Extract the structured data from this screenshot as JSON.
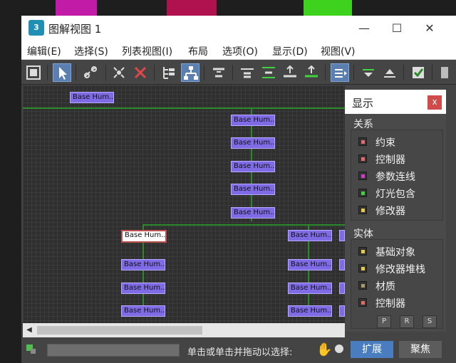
{
  "window": {
    "title": "图解视图 1",
    "app_icon": "3"
  },
  "controls": {
    "minimize": "—",
    "maximize": "☐",
    "close": "✕"
  },
  "menu": [
    "编辑(E)",
    "选择(S)",
    "列表视图(I)",
    "布局",
    "选项(O)",
    "显示(D)",
    "视图(V)"
  ],
  "canvas": {
    "node_label": "Base Hum...",
    "nodes": [
      "Base Hum...",
      "Base Hum...",
      "Base Hum...",
      "Base Hum...",
      "Base Hum...",
      "Base Hum...",
      "Base Hum...",
      "Base Hum...",
      "Base Hum...",
      "Base Hum...",
      "Base Hum...",
      "Base Hum...",
      "Base Hum...",
      "Base Hum...",
      "Base Hum...",
      "Base Hum..."
    ]
  },
  "panel": {
    "title": "显示",
    "close": "x",
    "relations_label": "关系",
    "relations": [
      {
        "label": "约束",
        "color": "#e36b6b"
      },
      {
        "label": "控制器",
        "color": "#e36b6b"
      },
      {
        "label": "参数连线",
        "color": "#d13ad1"
      },
      {
        "label": "灯光包含",
        "color": "#3fd43f"
      },
      {
        "label": "修改器",
        "color": "#e6c84a"
      }
    ],
    "entities_label": "实体",
    "entities": [
      {
        "label": "基础对象",
        "color": "#e6c84a"
      },
      {
        "label": "修改器堆栈",
        "color": "#e6c84a"
      },
      {
        "label": "材质",
        "color": "#a89a6a"
      },
      {
        "label": "控制器",
        "color": "#e36b6b"
      }
    ],
    "buttons": [
      "P",
      "R",
      "S"
    ]
  },
  "status": {
    "hint": "单击或单击并拖动以选择:",
    "expand": "扩展",
    "focus": "聚焦"
  },
  "colors": {
    "node": "#7f6be6",
    "link": "#2a8a2a",
    "accent": "#4a7dbf"
  }
}
